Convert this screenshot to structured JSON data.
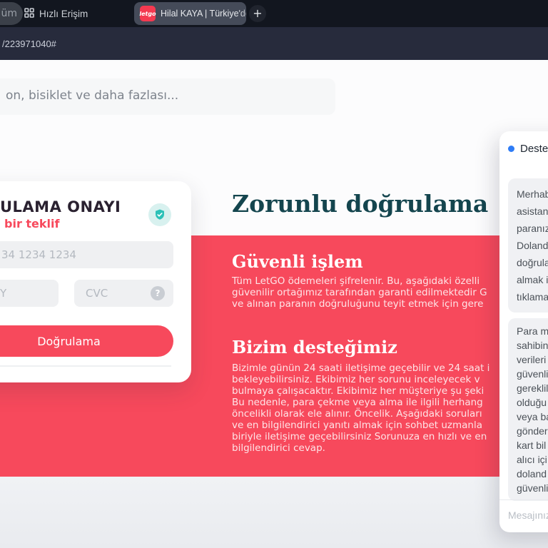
{
  "colors": {
    "accent_red": "#f7495c",
    "brand_red": "#f43950",
    "heading_teal": "#14454e",
    "shield_teal": "#2cc1b8",
    "chat_dot_blue": "#2e7cf6"
  },
  "browser": {
    "partial_tab_label": "üm",
    "quick_access_label": "Hızlı Erişim",
    "active_tab": {
      "favicon_text": "letgo",
      "title": "Hilal KAYA | Türkiye'deki İk"
    },
    "new_tab_label": "+",
    "url": "/223971040#"
  },
  "search": {
    "placeholder": "on, bisiklet ve daha fazlası..."
  },
  "card": {
    "title": "ULAMA ONAYI",
    "subtitle": "bir teklif",
    "card_number_placeholder": "34 1234 1234",
    "expiry_placeholder": "Y",
    "cvc_placeholder": "CVC",
    "cvc_help_label": "?",
    "submit_label": "Doğrulama"
  },
  "main": {
    "title": "Zorunlu doğrulama",
    "sections": [
      {
        "heading": "Güvenli işlem",
        "lines": [
          "Tüm LetGO ödemeleri şifrelenir. Bu, aşağıdaki özelli",
          "güvenilir ortağımız tarafından garanti edilmektedir G",
          "ve alınan paranın doğruluğunu teyit etmek için gere"
        ]
      },
      {
        "heading": "Bizim desteğimiz",
        "lines": [
          "Bizimle günün 24 saati iletişime geçebilir ve 24 saat i",
          "bekleyebilirsiniz. Ekibimiz her sorunu inceleyecek v",
          "bulmaya çalışacaktır. Ekibimiz her müşteriye şu şeki",
          "Bu nedenle, para çekme veya alma ile ilgili herhang",
          "öncelikli olarak ele alınır. Öncelik. Aşağıdaki soruları",
          "ve en bilgilendirici yanıtı almak için sohbet uzmanla",
          "biriyle iletişime geçebilirsiniz Sorunuza en hızlı ve en",
          "bilgilendirici cevap."
        ]
      }
    ]
  },
  "chat": {
    "header": "Destek",
    "messages": [
      {
        "lines": [
          "Merhaba",
          "asistanı",
          "paranız",
          "Doland",
          "doğrula",
          "almak i",
          "tıklama"
        ]
      },
      {
        "lines": [
          "Para ma",
          "sahibin",
          "verileri",
          "güvenli",
          "gereklil",
          "olduğu",
          "veya ba",
          "gönder",
          "kart bil",
          "alıcı içi",
          "doland",
          "güvenli"
        ]
      }
    ],
    "input_placeholder": "Mesajınız"
  }
}
